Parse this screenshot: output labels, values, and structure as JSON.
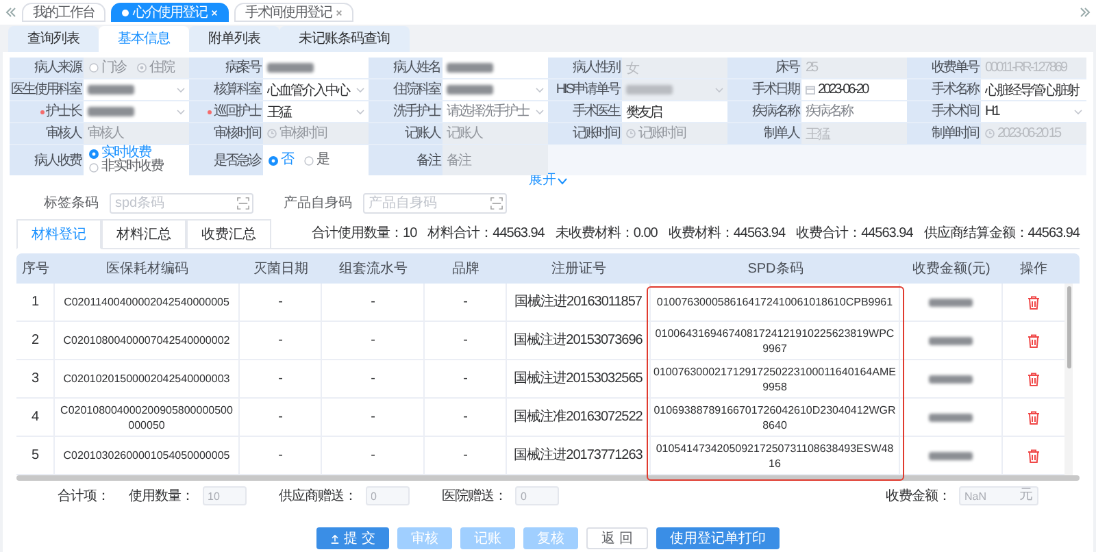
{
  "page_tabs": [
    {
      "label": "我的工作台",
      "selected": false
    },
    {
      "label": "心介使用登记",
      "selected": true
    },
    {
      "label": "手术间使用登记",
      "selected": false
    }
  ],
  "section_tabs": [
    {
      "label": "查询列表",
      "selected": false
    },
    {
      "label": "基本信息",
      "selected": true
    },
    {
      "label": "附单列表",
      "selected": false
    },
    {
      "label": "未记账条码查询",
      "selected": false
    }
  ],
  "form": {
    "rows": [
      [
        {
          "label": "病人来源",
          "kind": "radio",
          "disabled": true,
          "options": [
            {
              "label": "门诊",
              "selected": false
            },
            {
              "label": "住院",
              "selected": true
            }
          ]
        },
        {
          "label": "病案号",
          "kind": "text",
          "disabled": false,
          "masked": true
        },
        {
          "label": "病人姓名",
          "kind": "text",
          "disabled": false,
          "masked": true
        },
        {
          "label": "病人性别",
          "kind": "text",
          "disabled": true,
          "value": "女"
        },
        {
          "label": "床号",
          "kind": "text",
          "disabled": true,
          "value": "25"
        },
        {
          "label": "收费单号",
          "kind": "text",
          "disabled": true,
          "value": "00011-RR-127869"
        }
      ],
      [
        {
          "label": "医生使用科室",
          "kind": "select",
          "disabled": false,
          "masked": true
        },
        {
          "label": "核算科室",
          "kind": "select",
          "disabled": false,
          "value": "心血管介入中心"
        },
        {
          "label": "住院科室",
          "kind": "select",
          "disabled": false,
          "masked": true
        },
        {
          "label": "HIS申请单号",
          "kind": "select",
          "disabled": true,
          "masked": true
        },
        {
          "label": "手术日期",
          "kind": "date",
          "disabled": false,
          "value": "2023-06-20"
        },
        {
          "label": "手术名称",
          "kind": "text",
          "disabled": false,
          "value": "心脏经导管心脏射"
        }
      ],
      [
        {
          "label": "护士长",
          "required": true,
          "kind": "select",
          "disabled": false,
          "masked": true
        },
        {
          "label": "巡回护士",
          "required": true,
          "kind": "select",
          "disabled": false,
          "value": "王猛"
        },
        {
          "label": "洗手护士",
          "kind": "select",
          "disabled": false,
          "placeholder": "请选择洗手护士"
        },
        {
          "label": "手术医生",
          "kind": "text",
          "disabled": false,
          "value": "樊友启"
        },
        {
          "label": "疾病名称",
          "kind": "text",
          "disabled": false,
          "placeholder": "疾病名称"
        },
        {
          "label": "手术术间",
          "kind": "select",
          "disabled": false,
          "value": "H1"
        }
      ],
      [
        {
          "label": "审核人",
          "kind": "text",
          "disabled": true,
          "placeholder": "审核人"
        },
        {
          "label": "审核时间",
          "kind": "time",
          "disabled": true,
          "placeholder": "审核时间"
        },
        {
          "label": "记账人",
          "kind": "text",
          "disabled": true,
          "placeholder": "记账人"
        },
        {
          "label": "记账时间",
          "kind": "time",
          "disabled": true,
          "placeholder": "记账时间"
        },
        {
          "label": "制单人",
          "kind": "text",
          "disabled": true,
          "value": "王猛"
        },
        {
          "label": "制单时间",
          "kind": "time",
          "disabled": true,
          "value": "2023-06-20 15"
        }
      ],
      [
        {
          "label": "病人收费",
          "kind": "radio_stack",
          "disabled": false,
          "options": [
            {
              "label": "实时收费",
              "selected": true
            },
            {
              "label": "非实时收费",
              "selected": false
            }
          ]
        },
        {
          "label": "是否急诊",
          "kind": "radio",
          "disabled": false,
          "options": [
            {
              "label": "否",
              "selected": true
            },
            {
              "label": "是",
              "selected": false
            }
          ]
        },
        {
          "label": "备注",
          "kind": "text",
          "disabled": true,
          "placeholder": "备注"
        }
      ]
    ]
  },
  "expand_link": "展开",
  "barcode_fields": [
    {
      "label": "标签条码",
      "placeholder": "spd条码"
    },
    {
      "label": "产品自身码",
      "placeholder": "产品自身码"
    }
  ],
  "sub_tabs": [
    {
      "label": "材料登记",
      "selected": true
    },
    {
      "label": "材料汇总",
      "selected": false
    },
    {
      "label": "收费汇总",
      "selected": false
    }
  ],
  "summary": [
    {
      "label": "合计使用数量：",
      "value": "10"
    },
    {
      "label": "材料合计：",
      "value": "44563.94"
    },
    {
      "label": "未收费材料：",
      "value": "0.00"
    },
    {
      "label": "收费材料：",
      "value": "44563.94"
    },
    {
      "label": "收费合计：",
      "value": "44563.94"
    },
    {
      "label": "供应商结算金额：",
      "value": "44563.94"
    }
  ],
  "table": {
    "columns": [
      {
        "label": "序号",
        "highlighted": false
      },
      {
        "label": "医保耗材编码",
        "highlighted": false
      },
      {
        "label": "灭菌日期",
        "highlighted": false
      },
      {
        "label": "组套流水号",
        "highlighted": false
      },
      {
        "label": "品牌",
        "highlighted": false
      },
      {
        "label": "注册证号",
        "highlighted": false
      },
      {
        "label": "SPD条码",
        "highlighted": true
      },
      {
        "label": "收费金额(元)",
        "highlighted": false
      },
      {
        "label": "操作",
        "highlighted": false
      }
    ],
    "rows": [
      {
        "index": "1",
        "code": "C02011400400002042540000005",
        "sterilize_date": "-",
        "set_serial": "-",
        "brand": "-",
        "registration": "国械注进20163011857",
        "spd": "0100763000586164172410061018610CPB9961",
        "amount_masked": true
      },
      {
        "index": "2",
        "code": "C02010800400007042540000002",
        "sterilize_date": "-",
        "set_serial": "-",
        "brand": "-",
        "registration": "国械注进20153073696",
        "spd": "01006431694674081724121910225623819WPC9967",
        "amount_masked": true
      },
      {
        "index": "3",
        "code": "C02010201500002042540000003",
        "sterilize_date": "-",
        "set_serial": "-",
        "brand": "-",
        "registration": "国械注进20153032565",
        "spd": "010076300021712917250223100011640164AME9958",
        "amount_masked": true
      },
      {
        "index": "4",
        "code": "C020108004000200905800000500000050",
        "sterilize_date": "-",
        "set_serial": "-",
        "brand": "-",
        "registration": "国械注准20163072522",
        "spd": "01069388789166701726042610D23040412WGR8640",
        "amount_masked": true
      },
      {
        "index": "5",
        "code": "C02010302600001054050000005",
        "sterilize_date": "-",
        "set_serial": "-",
        "brand": "-",
        "registration": "国械注进20173771263",
        "spd": "010541473420509217250731108638493ESW4816",
        "amount_masked": true
      }
    ]
  },
  "totals": {
    "label": "合计项：",
    "items": [
      {
        "label": "使用数量：",
        "value": "10"
      },
      {
        "label": "供应商赠送：",
        "value": "0"
      },
      {
        "label": "医院赠送：",
        "value": "0"
      }
    ],
    "charge": {
      "label": "收费金额：",
      "value": "NaN",
      "unit": "元"
    }
  },
  "buttons": [
    {
      "label": "提 交",
      "kind": "primary",
      "has_icon": true
    },
    {
      "label": "审核",
      "kind": "disabled",
      "has_icon": false
    },
    {
      "label": "记账",
      "kind": "disabled",
      "has_icon": false
    },
    {
      "label": "复核",
      "kind": "disabled",
      "has_icon": false
    },
    {
      "label": "返 回",
      "kind": "plain",
      "has_icon": false
    },
    {
      "label": "使用登记单打印",
      "kind": "primary",
      "has_icon": false
    }
  ]
}
